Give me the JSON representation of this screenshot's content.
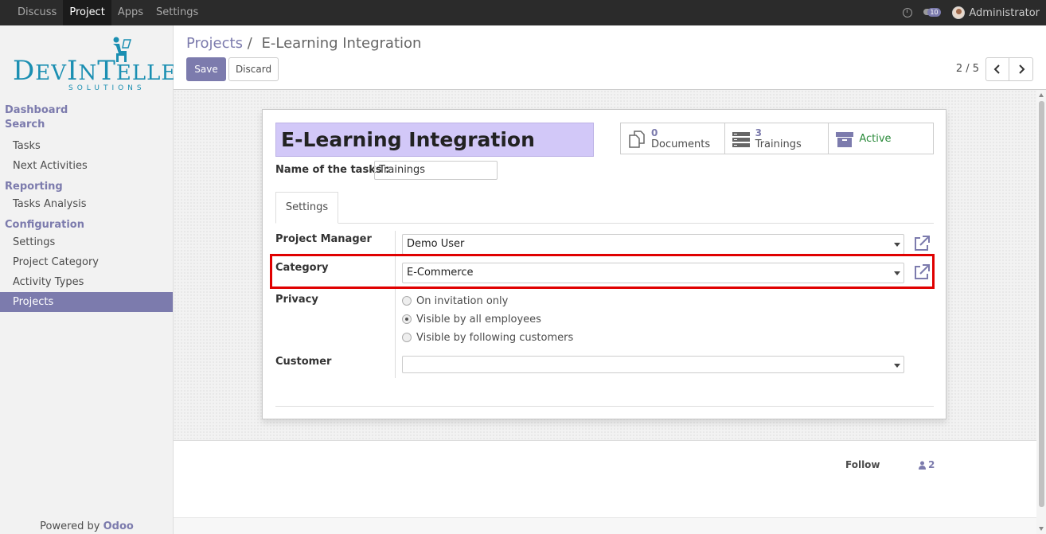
{
  "topbar": {
    "menu": [
      "Discuss",
      "Project",
      "Apps",
      "Settings"
    ],
    "active_menu": "Project",
    "message_count": "10",
    "user_name": "Administrator"
  },
  "logo": {
    "main": "DevIntelle",
    "sub": "SOLUTIONS"
  },
  "sidebar": {
    "sections": [
      {
        "title": "Dashboard",
        "items": []
      },
      {
        "title": "Search",
        "items": [
          "Tasks",
          "Next Activities"
        ]
      },
      {
        "title": "Reporting",
        "items": [
          "Tasks Analysis"
        ]
      },
      {
        "title": "Configuration",
        "items": [
          "Settings",
          "Project Category",
          "Activity Types",
          "Projects"
        ]
      }
    ],
    "active_item": "Projects",
    "powered_by": "Powered by",
    "powered_brand": "Odoo"
  },
  "control": {
    "breadcrumb_parent": "Projects",
    "breadcrumb_sep": "/",
    "breadcrumb_current": "E-Learning Integration",
    "save_label": "Save",
    "discard_label": "Discard",
    "pager": "2 / 5"
  },
  "form": {
    "title": "E-Learning Integration",
    "tasks_label": "Name of the tasks :",
    "tasks_value": "Trainings",
    "smart_buttons": [
      {
        "count": "0",
        "label": "Documents",
        "icon": "documents-icon"
      },
      {
        "count": "3",
        "label": "Trainings",
        "icon": "tasks-icon"
      },
      {
        "count": "",
        "label": "Active",
        "icon": "archive-icon"
      }
    ],
    "tab_label": "Settings",
    "project_manager_label": "Project Manager",
    "project_manager_value": "Demo User",
    "category_label": "Category",
    "category_value": "E-Commerce",
    "privacy_label": "Privacy",
    "privacy_options": [
      "On invitation only",
      "Visible by all employees",
      "Visible by following customers"
    ],
    "privacy_selected": "Visible by all employees",
    "customer_label": "Customer",
    "customer_value": ""
  },
  "chatter": {
    "follow_label": "Follow",
    "followers_count": "2"
  },
  "colors": {
    "primary": "#7c7bad",
    "highlight": "#e00000",
    "title_bg": "#d2c8f8",
    "active": "#2a8a3a"
  }
}
